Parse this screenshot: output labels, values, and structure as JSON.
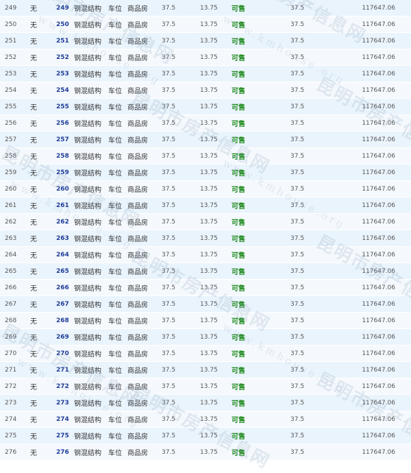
{
  "table": {
    "rows": [
      {
        "seq": "249",
        "flag": "无",
        "room": "249",
        "structure": "钢混结构",
        "use": "车位",
        "type": "商品房",
        "area1": "37.5",
        "area2": "13.75",
        "status": "可售",
        "area3": "37.5",
        "price": "117647.06"
      },
      {
        "seq": "250",
        "flag": "无",
        "room": "250",
        "structure": "钢混结构",
        "use": "车位",
        "type": "商品房",
        "area1": "37.5",
        "area2": "13.75",
        "status": "可售",
        "area3": "37.5",
        "price": "117647.06"
      },
      {
        "seq": "251",
        "flag": "无",
        "room": "251",
        "structure": "钢混结构",
        "use": "车位",
        "type": "商品房",
        "area1": "37.5",
        "area2": "13.75",
        "status": "可售",
        "area3": "37.5",
        "price": "117647.06"
      },
      {
        "seq": "252",
        "flag": "无",
        "room": "252",
        "structure": "钢混结构",
        "use": "车位",
        "type": "商品房",
        "area1": "37.5",
        "area2": "13.75",
        "status": "可售",
        "area3": "37.5",
        "price": "117647.06"
      },
      {
        "seq": "253",
        "flag": "无",
        "room": "253",
        "structure": "钢混结构",
        "use": "车位",
        "type": "商品房",
        "area1": "37.5",
        "area2": "13.75",
        "status": "可售",
        "area3": "37.5",
        "price": "117647.06"
      },
      {
        "seq": "254",
        "flag": "无",
        "room": "254",
        "structure": "钢混结构",
        "use": "车位",
        "type": "商品房",
        "area1": "37.5",
        "area2": "13.75",
        "status": "可售",
        "area3": "37.5",
        "price": "117647.06"
      },
      {
        "seq": "255",
        "flag": "无",
        "room": "255",
        "structure": "钢混结构",
        "use": "车位",
        "type": "商品房",
        "area1": "37.5",
        "area2": "13.75",
        "status": "可售",
        "area3": "37.5",
        "price": "117647.06"
      },
      {
        "seq": "256",
        "flag": "无",
        "room": "256",
        "structure": "钢混结构",
        "use": "车位",
        "type": "商品房",
        "area1": "37.5",
        "area2": "13.75",
        "status": "可售",
        "area3": "37.5",
        "price": "117647.06"
      },
      {
        "seq": "257",
        "flag": "无",
        "room": "257",
        "structure": "钢混结构",
        "use": "车位",
        "type": "商品房",
        "area1": "37.5",
        "area2": "13.75",
        "status": "可售",
        "area3": "37.5",
        "price": "117647.06"
      },
      {
        "seq": "258",
        "flag": "无",
        "room": "258",
        "structure": "钢混结构",
        "use": "车位",
        "type": "商品房",
        "area1": "37.5",
        "area2": "13.75",
        "status": "可售",
        "area3": "37.5",
        "price": "117647.06"
      },
      {
        "seq": "259",
        "flag": "无",
        "room": "259",
        "structure": "钢混结构",
        "use": "车位",
        "type": "商品房",
        "area1": "37.5",
        "area2": "13.75",
        "status": "可售",
        "area3": "37.5",
        "price": "117647.06"
      },
      {
        "seq": "260",
        "flag": "无",
        "room": "260",
        "structure": "钢混结构",
        "use": "车位",
        "type": "商品房",
        "area1": "37.5",
        "area2": "13.75",
        "status": "可售",
        "area3": "37.5",
        "price": "117647.06"
      },
      {
        "seq": "261",
        "flag": "无",
        "room": "261",
        "structure": "钢混结构",
        "use": "车位",
        "type": "商品房",
        "area1": "37.5",
        "area2": "13.75",
        "status": "可售",
        "area3": "37.5",
        "price": "117647.06"
      },
      {
        "seq": "262",
        "flag": "无",
        "room": "262",
        "structure": "钢混结构",
        "use": "车位",
        "type": "商品房",
        "area1": "37.5",
        "area2": "13.75",
        "status": "可售",
        "area3": "37.5",
        "price": "117647.06"
      },
      {
        "seq": "263",
        "flag": "无",
        "room": "263",
        "structure": "钢混结构",
        "use": "车位",
        "type": "商品房",
        "area1": "37.5",
        "area2": "13.75",
        "status": "可售",
        "area3": "37.5",
        "price": "117647.06"
      },
      {
        "seq": "264",
        "flag": "无",
        "room": "264",
        "structure": "钢混结构",
        "use": "车位",
        "type": "商品房",
        "area1": "37.5",
        "area2": "13.75",
        "status": "可售",
        "area3": "37.5",
        "price": "117647.06"
      },
      {
        "seq": "265",
        "flag": "无",
        "room": "265",
        "structure": "钢混结构",
        "use": "车位",
        "type": "商品房",
        "area1": "37.5",
        "area2": "13.75",
        "status": "可售",
        "area3": "37.5",
        "price": "117647.06"
      },
      {
        "seq": "266",
        "flag": "无",
        "room": "266",
        "structure": "钢混结构",
        "use": "车位",
        "type": "商品房",
        "area1": "37.5",
        "area2": "13.75",
        "status": "可售",
        "area3": "37.5",
        "price": "117647.06"
      },
      {
        "seq": "267",
        "flag": "无",
        "room": "267",
        "structure": "钢混结构",
        "use": "车位",
        "type": "商品房",
        "area1": "37.5",
        "area2": "13.75",
        "status": "可售",
        "area3": "37.5",
        "price": "117647.06"
      },
      {
        "seq": "268",
        "flag": "无",
        "room": "268",
        "structure": "钢混结构",
        "use": "车位",
        "type": "商品房",
        "area1": "37.5",
        "area2": "13.75",
        "status": "可售",
        "area3": "37.5",
        "price": "117647.06"
      },
      {
        "seq": "269",
        "flag": "无",
        "room": "269",
        "structure": "钢混结构",
        "use": "车位",
        "type": "商品房",
        "area1": "37.5",
        "area2": "13.75",
        "status": "可售",
        "area3": "37.5",
        "price": "117647.06"
      },
      {
        "seq": "270",
        "flag": "无",
        "room": "270",
        "structure": "钢混结构",
        "use": "车位",
        "type": "商品房",
        "area1": "37.5",
        "area2": "13.75",
        "status": "可售",
        "area3": "37.5",
        "price": "117647.06"
      },
      {
        "seq": "271",
        "flag": "无",
        "room": "271",
        "structure": "钢混结构",
        "use": "车位",
        "type": "商品房",
        "area1": "37.5",
        "area2": "13.75",
        "status": "可售",
        "area3": "37.5",
        "price": "117647.06"
      },
      {
        "seq": "272",
        "flag": "无",
        "room": "272",
        "structure": "钢混结构",
        "use": "车位",
        "type": "商品房",
        "area1": "37.5",
        "area2": "13.75",
        "status": "可售",
        "area3": "37.5",
        "price": "117647.06"
      },
      {
        "seq": "273",
        "flag": "无",
        "room": "273",
        "structure": "钢混结构",
        "use": "车位",
        "type": "商品房",
        "area1": "37.5",
        "area2": "13.75",
        "status": "可售",
        "area3": "37.5",
        "price": "117647.06"
      },
      {
        "seq": "274",
        "flag": "无",
        "room": "274",
        "structure": "钢混结构",
        "use": "车位",
        "type": "商品房",
        "area1": "37.5",
        "area2": "13.75",
        "status": "可售",
        "area3": "37.5",
        "price": "117647.06"
      },
      {
        "seq": "275",
        "flag": "无",
        "room": "275",
        "structure": "钢混结构",
        "use": "车位",
        "type": "商品房",
        "area1": "37.5",
        "area2": "13.75",
        "status": "可售",
        "area3": "37.5",
        "price": "117647.06"
      },
      {
        "seq": "276",
        "flag": "无",
        "room": "276",
        "structure": "钢混结构",
        "use": "车位",
        "type": "商品房",
        "area1": "37.5",
        "area2": "13.75",
        "status": "可售",
        "area3": "37.5",
        "price": "117647.06"
      }
    ]
  },
  "watermark": {
    "site_name_cn": "昆明市房产信息网",
    "site_url": "www.kmhouse.org"
  },
  "colors": {
    "row_odd": "#eaf4fc",
    "row_even": "#f5f9fd",
    "room_link": "#1f3c98",
    "status_available": "#1e8a1e"
  }
}
